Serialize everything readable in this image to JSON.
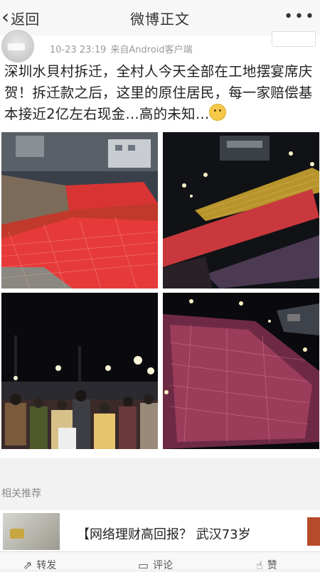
{
  "header": {
    "back_label": "返回",
    "title": "微博正文",
    "more_glyph": "•••"
  },
  "post": {
    "time": "10-23 23:19",
    "source": "来自Android客户端",
    "text": "深圳水貝村拆迁，全村人今天全部在工地摆宴席庆贺！拆迁款之后，这里的原住居民，每一家赔偿基本接近2亿左右现金…高的未知…",
    "images": [
      {
        "name": "banquet-red-tables-aerial-1"
      },
      {
        "name": "banquet-stadium-night-2"
      },
      {
        "name": "banquet-crowd-night-3"
      },
      {
        "name": "banquet-stadium-night-4"
      }
    ]
  },
  "related": {
    "label": "相关推荐",
    "title": "【网络理财高回报？ 武汉73岁"
  },
  "bottom_bar": {
    "repost": "转发",
    "comment": "评论",
    "like": "赞"
  }
}
